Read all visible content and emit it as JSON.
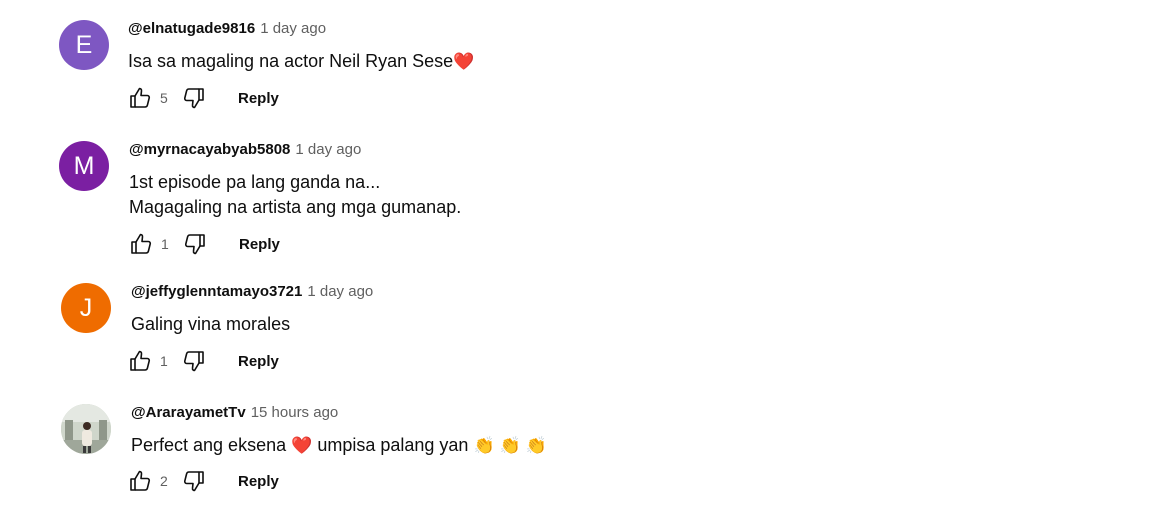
{
  "comments": [
    {
      "avatar_letter": "E",
      "avatar_color": "#7e57c2",
      "author": "@elnatugade9816",
      "time": "1 day ago",
      "lines": [
        "Isa sa magaling na actor Neil Ryan Sese"
      ],
      "emoji": [
        "❤️"
      ],
      "likes": "5",
      "reply_label": "Reply"
    },
    {
      "avatar_letter": "M",
      "avatar_color": "#7b1fa2",
      "author": "@myrnacayabyab5808",
      "time": "1 day ago",
      "lines": [
        "1st episode pa lang ganda na...",
        "Magagaling na artista ang mga gumanap."
      ],
      "likes": "1",
      "reply_label": "Reply"
    },
    {
      "avatar_letter": "J",
      "avatar_color": "#ef6c00",
      "author": "@jeffyglenntamayo3721",
      "time": "1 day ago",
      "lines": [
        "Galing vina morales"
      ],
      "likes": "1",
      "reply_label": "Reply"
    },
    {
      "avatar_letter": "",
      "avatar_color": "#9aa39a",
      "author": "@ArarayametTv",
      "time": "15 hours ago",
      "text_parts": [
        "Perfect ang eksena",
        "umpisa palang yan"
      ],
      "emoji": [
        "❤️",
        "👏",
        "👏",
        "👏"
      ],
      "likes": "2",
      "reply_label": "Reply"
    }
  ]
}
